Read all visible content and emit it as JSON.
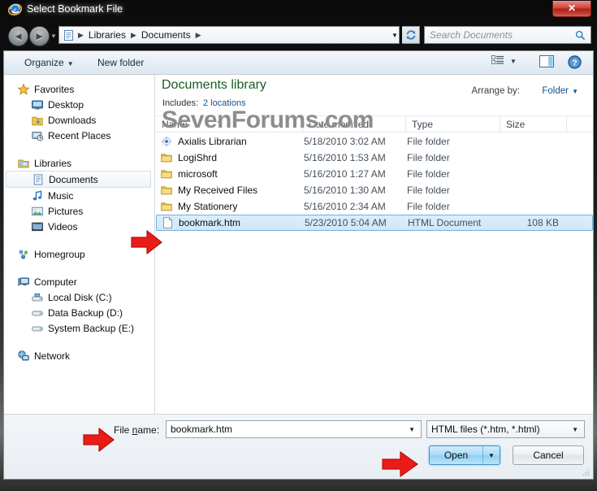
{
  "window": {
    "title": "Select Bookmark File",
    "app_icon": "internet-explorer-icon",
    "close_label": "✕"
  },
  "nav": {
    "back_icon": "back-arrow-icon",
    "forward_icon": "forward-arrow-icon",
    "history_caret": "▼",
    "address_icon": "documents-library-icon",
    "breadcrumbs": [
      "Libraries",
      "Documents"
    ],
    "separator": "▶",
    "address_caret": "▼",
    "refresh_icon": "refresh-icon"
  },
  "search": {
    "placeholder": "Search Documents",
    "icon": "search-icon"
  },
  "toolbar": {
    "organize_label": "Organize",
    "organize_caret": "▼",
    "new_folder_label": "New folder",
    "views_icon": "view-options-icon",
    "views_caret": "▼",
    "preview_icon": "preview-pane-icon",
    "help_icon": "help-icon"
  },
  "watermark": {
    "text": "SevenForums.com"
  },
  "sidebar": {
    "groups": [
      {
        "root": {
          "label": "Favorites",
          "icon": "star-icon"
        },
        "children": [
          {
            "label": "Desktop",
            "icon": "desktop-icon"
          },
          {
            "label": "Downloads",
            "icon": "downloads-icon"
          },
          {
            "label": "Recent Places",
            "icon": "recent-places-icon"
          }
        ]
      },
      {
        "root": {
          "label": "Libraries",
          "icon": "libraries-icon"
        },
        "children": [
          {
            "label": "Documents",
            "icon": "documents-icon",
            "selected": true
          },
          {
            "label": "Music",
            "icon": "music-icon"
          },
          {
            "label": "Pictures",
            "icon": "pictures-icon"
          },
          {
            "label": "Videos",
            "icon": "videos-icon"
          }
        ]
      },
      {
        "root": {
          "label": "Homegroup",
          "icon": "homegroup-icon"
        },
        "children": []
      },
      {
        "root": {
          "label": "Computer",
          "icon": "computer-icon"
        },
        "children": [
          {
            "label": "Local Disk (C:)",
            "icon": "system-drive-icon"
          },
          {
            "label": "Data Backup (D:)",
            "icon": "drive-icon"
          },
          {
            "label": "System Backup (E:)",
            "icon": "drive-icon"
          }
        ]
      },
      {
        "root": {
          "label": "Network",
          "icon": "network-icon"
        },
        "children": []
      }
    ]
  },
  "library": {
    "title": "Documents library",
    "includes_label": "Includes:",
    "includes_value": "2 locations",
    "arrange_label": "Arrange by:",
    "arrange_value": "Folder",
    "arrange_caret": "▼"
  },
  "columns": [
    {
      "label": "Name",
      "sorted": true,
      "sort_glyph": "▲"
    },
    {
      "label": "Date modified"
    },
    {
      "label": "Type"
    },
    {
      "label": "Size"
    }
  ],
  "files": [
    {
      "name": "Axialis Librarian",
      "date": "5/18/2010 3:02 AM",
      "type": "File folder",
      "size": "",
      "icon": "axialis-folder-icon",
      "selected": false
    },
    {
      "name": "LogiShrd",
      "date": "5/16/2010 1:53 AM",
      "type": "File folder",
      "size": "",
      "icon": "folder-icon",
      "selected": false
    },
    {
      "name": "microsoft",
      "date": "5/16/2010 1:27 AM",
      "type": "File folder",
      "size": "",
      "icon": "folder-icon",
      "selected": false
    },
    {
      "name": "My Received Files",
      "date": "5/16/2010 1:30 AM",
      "type": "File folder",
      "size": "",
      "icon": "folder-icon",
      "selected": false
    },
    {
      "name": "My Stationery",
      "date": "5/16/2010 2:34 AM",
      "type": "File folder",
      "size": "",
      "icon": "folder-icon",
      "selected": false
    },
    {
      "name": "bookmark.htm",
      "date": "5/23/2010 5:04 AM",
      "type": "HTML Document",
      "size": "108 KB",
      "icon": "html-file-icon",
      "selected": true
    }
  ],
  "bottom": {
    "filename_label_pre": "File ",
    "filename_label_accel": "n",
    "filename_label_post": "ame:",
    "filename_value": "bookmark.htm",
    "filename_caret": "▼",
    "filter_value": "HTML files (*.htm, *.html)",
    "filter_caret": "▼",
    "open_label": "Open",
    "open_caret": "▼",
    "cancel_label": "Cancel"
  },
  "annotations": {
    "arrow_color": "#e01b1b",
    "arrows": [
      "arrow-selected-file",
      "arrow-filename-field",
      "arrow-open-button"
    ]
  }
}
